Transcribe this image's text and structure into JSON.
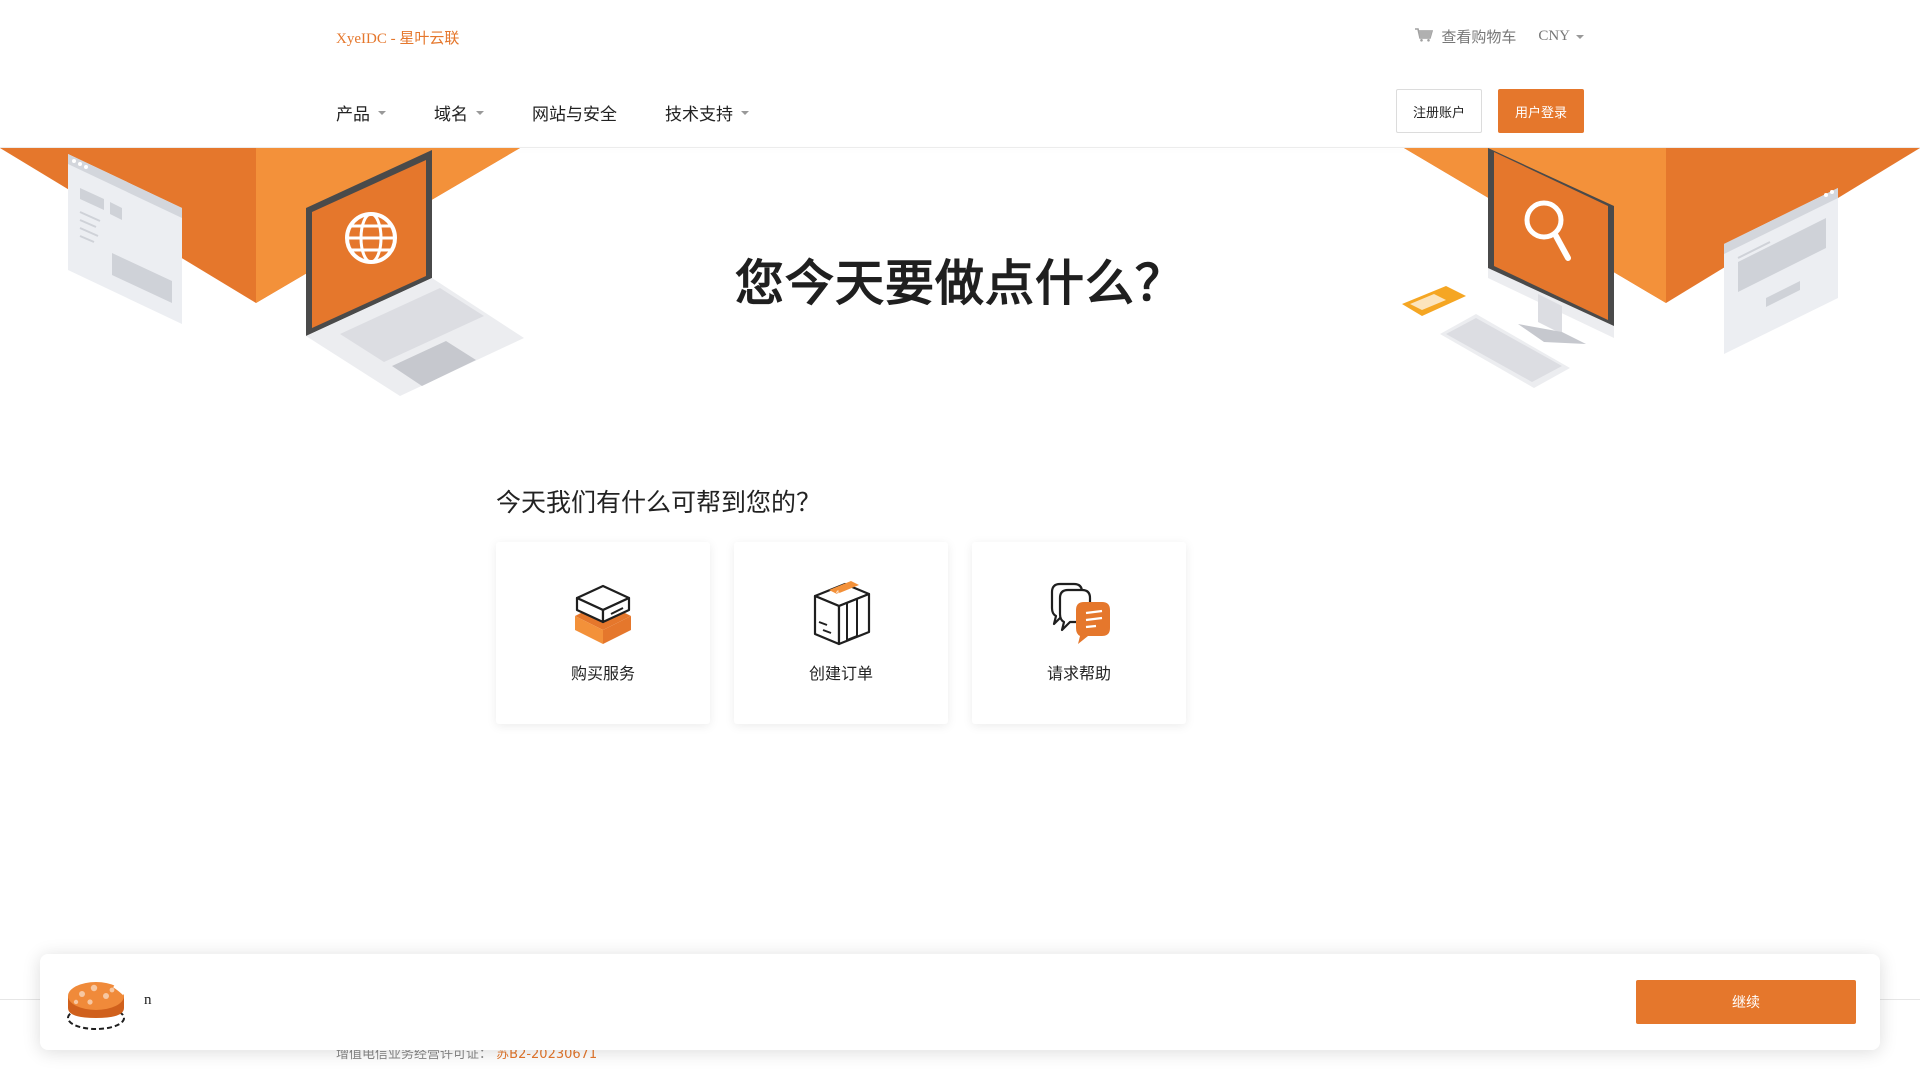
{
  "header": {
    "brand": "XyeIDC - 星叶云联",
    "cart_label": "查看购物车",
    "currency": "CNY"
  },
  "nav": {
    "items": [
      {
        "label": "产品",
        "dropdown": true
      },
      {
        "label": "域名",
        "dropdown": true
      },
      {
        "label": "网站与安全",
        "dropdown": false
      },
      {
        "label": "技术支持",
        "dropdown": true
      }
    ],
    "register_label": "注册账户",
    "login_label": "用户登录"
  },
  "hero": {
    "title": "您今天要做点什么？"
  },
  "help": {
    "heading": "今天我们有什么可帮到您的？",
    "cards": [
      {
        "label": "购买服务",
        "icon": "box-icon"
      },
      {
        "label": "创建订单",
        "icon": "package-icon"
      },
      {
        "label": "请求帮助",
        "icon": "chat-bubbles-icon"
      }
    ]
  },
  "footer": {
    "license_label": "增值电信业务经营许可证：",
    "license_number": "苏B2-20230671"
  },
  "cookie": {
    "text": "n",
    "button_label": "继续"
  },
  "colors": {
    "accent": "#e5772c",
    "accent_light": "#f3913a",
    "text": "#222222"
  }
}
